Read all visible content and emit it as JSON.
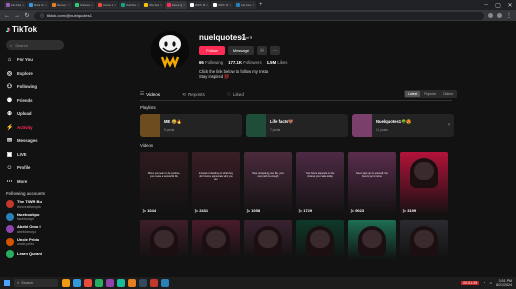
{
  "browser": {
    "tabs": [
      {
        "label": "Lilo Aubers",
        "color": "#9b59b6"
      },
      {
        "label": "Mova Ya Ca",
        "color": "#3498db"
      },
      {
        "label": "Recoup Yo",
        "color": "#e67e22"
      },
      {
        "label": "Achievement",
        "color": "#2ecc71"
      },
      {
        "label": "Course Inst",
        "color": "#e74c3c"
      },
      {
        "label": "Vedi Music",
        "color": "#16a085"
      },
      {
        "label": "Vibe Splash",
        "color": "#f1c40f"
      },
      {
        "label": "kissed (@)",
        "color": "#fe2c55",
        "active": true
      },
      {
        "label": "2027k Tik",
        "color": "#ffffff"
      },
      {
        "label": "2027k Tik",
        "color": "#ffffff"
      },
      {
        "label": "Get more",
        "color": "#2980b9"
      }
    ],
    "url": "tiktok.com/@nuelquotes1"
  },
  "sidebar": {
    "logo": "TikTok",
    "search_placeholder": "Search",
    "nav": [
      {
        "label": "For You",
        "icon": "home-icon",
        "glyph": "⌂"
      },
      {
        "label": "Explore",
        "icon": "compass-icon",
        "glyph": "◎"
      },
      {
        "label": "Following",
        "icon": "following-icon",
        "glyph": "⚇"
      },
      {
        "label": "Friends",
        "icon": "friends-icon",
        "glyph": "⚉"
      },
      {
        "label": "Upload",
        "icon": "upload-icon",
        "glyph": "⊕"
      },
      {
        "label": "Activity",
        "icon": "activity-icon",
        "glyph": "⚡",
        "active": true
      },
      {
        "label": "Messages",
        "icon": "messages-icon",
        "glyph": "✉"
      },
      {
        "label": "LIVE",
        "icon": "live-icon",
        "glyph": "▣"
      },
      {
        "label": "Profile",
        "icon": "profile-icon",
        "glyph": "☺"
      },
      {
        "label": "More",
        "icon": "more-icon",
        "glyph": "⋯"
      }
    ],
    "following_title": "Following accounts",
    "accounts": [
      {
        "name": "The TIWR Bu",
        "user": "thecreativespla",
        "color": "#c0392b"
      },
      {
        "name": "facebookpo",
        "user": "facebookpl",
        "color": "#2980b9"
      },
      {
        "name": "Abebi Omo I",
        "user": "abebiomoyo",
        "color": "#8e44ad"
      },
      {
        "name": "Uncle Prido",
        "user": "uncle.prido",
        "color": "#d35400"
      },
      {
        "name": "Learn Qurani",
        "user": "",
        "color": "#27ae60"
      }
    ]
  },
  "profile": {
    "username": "nuelquotes1",
    "nickname": "Nuel✞",
    "follow_label": "Follow",
    "message_label": "Message",
    "stats": [
      {
        "value": "66",
        "label": "Following"
      },
      {
        "value": "177.1K",
        "label": "Followers"
      },
      {
        "value": "1.5M",
        "label": "Likes"
      }
    ],
    "bio_line1": "Click the link below to follow my Insta",
    "bio_line2": "Stay inspired 💯"
  },
  "tabs": [
    {
      "label": "Videos",
      "icon": "grid-icon",
      "glyph": "☷",
      "active": true
    },
    {
      "label": "Reposts",
      "icon": "repost-icon",
      "glyph": "⟲"
    },
    {
      "label": "Liked",
      "icon": "heart-icon",
      "glyph": "♡"
    }
  ],
  "sort": {
    "latest": "Latest",
    "popular": "Popular",
    "oldest": "Oldest"
  },
  "playlists_label": "Playlists",
  "playlists": [
    {
      "name": "ME 😂🔥",
      "count": "9 posts",
      "color": "#6d4c1f"
    },
    {
      "name": "Life facts🤎",
      "count": "7 posts",
      "color": "#1e4d3a"
    },
    {
      "name": "Nuelquotes1🌳😍",
      "count": "11 posts",
      "color": "#7b3f6b"
    }
  ],
  "videos_label": "Videos",
  "videos": [
    {
      "views": "1044",
      "bg": "#2e1b1f",
      "text": "When you learn to be positive, you create a wonderful life"
    },
    {
      "views": "2431",
      "bg": "#3a1e26",
      "text": "Instead of dwelling on what they don't know, appreciate who you are"
    },
    {
      "views": "1058",
      "bg": "#4a2a3c",
      "text": "Stop comparing your life, your own path is enough"
    },
    {
      "views": "1729",
      "bg": "#4d2a44",
      "text": "Your future depends on the choices you make today"
    },
    {
      "views": "9023",
      "bg": "#5a2d4c",
      "text": "Never give up on yourself, the best is yet to come"
    },
    {
      "views": "3199",
      "bg": "#b3123a",
      "text": ""
    },
    {
      "views": "",
      "bg": "#3d1e2a",
      "text": ""
    },
    {
      "views": "",
      "bg": "#4a1b2a",
      "text": ""
    },
    {
      "views": "",
      "bg": "#3a2230",
      "text": ""
    },
    {
      "views": "",
      "bg": "#0e3a2a",
      "text": ""
    },
    {
      "views": "",
      "bg": "#1d6e54",
      "text": ""
    },
    {
      "views": "",
      "bg": "#2b2b30",
      "text": ""
    }
  ],
  "taskbar": {
    "search_placeholder": "Search",
    "time": "3:51 PM",
    "date": "8/21/2024",
    "recording": "00:01:35",
    "apps": [
      "#f39c12",
      "#3498db",
      "#e74c3c",
      "#27ae60",
      "#8e44ad",
      "#1abc9c",
      "#e67e22",
      "#34495e",
      "#c0392b",
      "#2980b9"
    ]
  }
}
